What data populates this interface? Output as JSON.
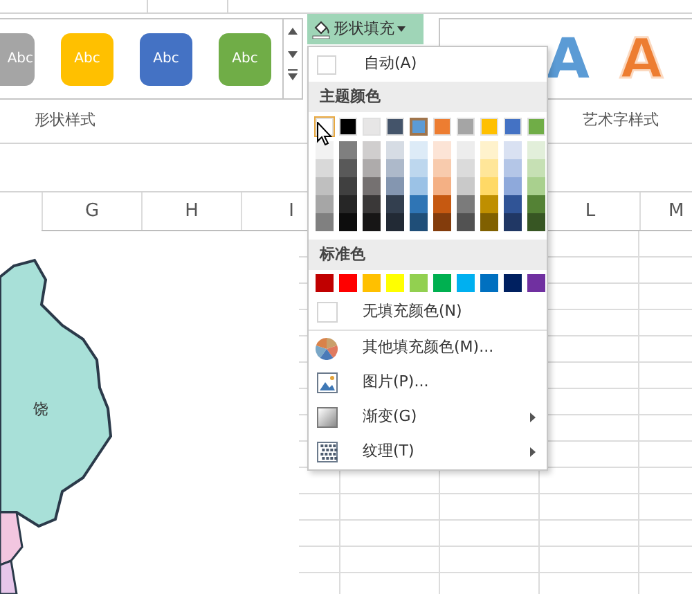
{
  "ribbon": {
    "shape_styles": {
      "swatches": [
        {
          "label": "Abc",
          "color": "#a5a5a5"
        },
        {
          "label": "Abc",
          "color": "#ffc000"
        },
        {
          "label": "Abc",
          "color": "#4472c4"
        },
        {
          "label": "Abc",
          "color": "#70ad47"
        }
      ],
      "group_label": "形状样式"
    },
    "fill_button": {
      "label": "形状填充",
      "open": true
    },
    "wordart_styles": {
      "samples": [
        {
          "label": "A",
          "color": "#5b9bd5",
          "kind": "filled"
        },
        {
          "label": "A",
          "color": "#ed7d31",
          "kind": "outline"
        }
      ],
      "group_label": "艺术字样式"
    }
  },
  "columns": [
    "G",
    "H",
    "I",
    "L",
    "M"
  ],
  "menu": {
    "auto": "自动(A)",
    "theme_header": "主题颜色",
    "theme": [
      {
        "color": "#ffffff",
        "selected": false,
        "hovered": true,
        "shades": [
          {
            "color": "#f2f2f2"
          },
          {
            "color": "#d9d9d9"
          },
          {
            "color": "#bfbfbf"
          },
          {
            "color": "#a6a6a6"
          },
          {
            "color": "#808080"
          }
        ]
      },
      {
        "color": "#000000",
        "selected": false,
        "hovered": false,
        "shades": [
          {
            "color": "#7f7f7f"
          },
          {
            "color": "#595959"
          },
          {
            "color": "#404040"
          },
          {
            "color": "#262626"
          },
          {
            "color": "#0d0d0d"
          }
        ]
      },
      {
        "color": "#e7e6e6",
        "selected": false,
        "hovered": false,
        "shades": [
          {
            "color": "#d0cece"
          },
          {
            "color": "#aeabab"
          },
          {
            "color": "#757171"
          },
          {
            "color": "#3a3838"
          },
          {
            "color": "#171616"
          }
        ]
      },
      {
        "color": "#44546a",
        "selected": false,
        "hovered": false,
        "shades": [
          {
            "color": "#d6dce4"
          },
          {
            "color": "#adb9ca"
          },
          {
            "color": "#8496b0"
          },
          {
            "color": "#333f4f"
          },
          {
            "color": "#222a35"
          }
        ]
      },
      {
        "color": "#5b9bd5",
        "selected": true,
        "hovered": false,
        "shades": [
          {
            "color": "#ddebf7"
          },
          {
            "color": "#bdd7ee"
          },
          {
            "color": "#9bc2e6"
          },
          {
            "color": "#2f75b5"
          },
          {
            "color": "#1f4e78"
          }
        ]
      },
      {
        "color": "#ed7d31",
        "selected": false,
        "hovered": false,
        "shades": [
          {
            "color": "#fce4d6"
          },
          {
            "color": "#f8cbad"
          },
          {
            "color": "#f4b084"
          },
          {
            "color": "#c65911"
          },
          {
            "color": "#833c0c"
          }
        ]
      },
      {
        "color": "#a5a5a5",
        "selected": false,
        "hovered": false,
        "shades": [
          {
            "color": "#ededed"
          },
          {
            "color": "#dbdbdb"
          },
          {
            "color": "#c9c9c9"
          },
          {
            "color": "#7b7b7b"
          },
          {
            "color": "#525252"
          }
        ]
      },
      {
        "color": "#ffc000",
        "selected": false,
        "hovered": false,
        "shades": [
          {
            "color": "#fff2cc"
          },
          {
            "color": "#ffe699"
          },
          {
            "color": "#ffd966"
          },
          {
            "color": "#bf8f00"
          },
          {
            "color": "#806000"
          }
        ]
      },
      {
        "color": "#4472c4",
        "selected": false,
        "hovered": false,
        "shades": [
          {
            "color": "#d9e1f2"
          },
          {
            "color": "#b4c6e7"
          },
          {
            "color": "#8ea9db"
          },
          {
            "color": "#305496"
          },
          {
            "color": "#203764"
          }
        ]
      },
      {
        "color": "#70ad47",
        "selected": false,
        "hovered": false,
        "shades": [
          {
            "color": "#e2efda"
          },
          {
            "color": "#c6e0b4"
          },
          {
            "color": "#a9d08e"
          },
          {
            "color": "#548235"
          },
          {
            "color": "#375623"
          }
        ]
      }
    ],
    "standard_header": "标准色",
    "standard": [
      {
        "color": "#c00000"
      },
      {
        "color": "#ff0000"
      },
      {
        "color": "#ffc000"
      },
      {
        "color": "#ffff00"
      },
      {
        "color": "#92d050"
      },
      {
        "color": "#00b050"
      },
      {
        "color": "#00b0f0"
      },
      {
        "color": "#0070c0"
      },
      {
        "color": "#002060"
      },
      {
        "color": "#7030a0"
      }
    ],
    "items": [
      {
        "label": "无填充颜色(N)",
        "kind": "none",
        "submenu": false
      },
      {
        "label": "其他填充颜色(M)...",
        "kind": "more",
        "submenu": false
      },
      {
        "label": "图片(P)...",
        "kind": "picture",
        "submenu": false
      },
      {
        "label": "渐变(G)",
        "kind": "gradient",
        "submenu": true
      },
      {
        "label": "纹理(T)",
        "kind": "texture",
        "submenu": true
      }
    ]
  },
  "map": {
    "label": "饶"
  }
}
